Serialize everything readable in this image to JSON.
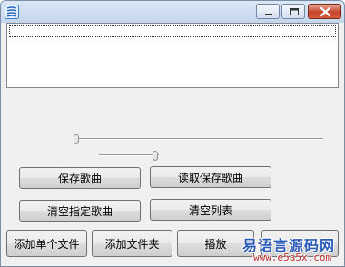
{
  "window": {
    "icon": "app-icon",
    "controls": {
      "minimize_icon": "minimize-icon",
      "maximize_icon": "maximize-icon",
      "close_icon": "close-icon"
    }
  },
  "playlist": {
    "items": []
  },
  "sliders": {
    "progress": {
      "value": 0.0
    },
    "volume": {
      "value": 0.98
    }
  },
  "buttons": {
    "save_songs": "保存歌曲",
    "load_saved_songs": "读取保存歌曲",
    "clear_selected_song": "清空指定歌曲",
    "clear_list": "清空列表",
    "add_single_file": "添加单个文件",
    "add_folder": "添加文件夹",
    "play": "播放",
    "stop": "停止"
  },
  "watermark": {
    "cn": "易语言源码网",
    "en": "www.e5a5x.com"
  }
}
